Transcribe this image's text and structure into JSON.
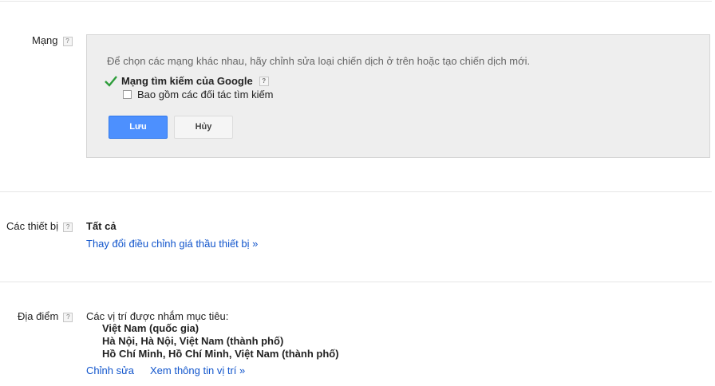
{
  "network": {
    "label": "Mạng",
    "help": "?",
    "note": "Để chọn các mạng khác nhau, hãy chỉnh sửa loại chiến dịch ở trên hoặc tạo chiến dịch mới.",
    "search_network": "Mạng tìm kiếm của Google",
    "search_partners": "Bao gồm các đối tác tìm kiếm",
    "save_label": "Lưu",
    "cancel_label": "Hủy"
  },
  "devices": {
    "label": "Các thiết bị",
    "help": "?",
    "value": "Tất cả",
    "change_link": "Thay đổi điều chỉnh giá thầu thiết bị »"
  },
  "locations": {
    "label": "Địa điểm",
    "help": "?",
    "targeted_label": "Các vị trí được nhắm mục tiêu:",
    "items": [
      "Việt Nam (quốc gia)",
      "Hà Nội, Hà Nội, Việt Nam (thành phố)",
      "Hồ Chí Minh, Hồ Chí Minh, Việt Nam (thành phố)"
    ],
    "edit_link": "Chỉnh sửa",
    "view_link": "Xem thông tin vị trí »"
  },
  "colors": {
    "link": "#1155cc",
    "primary_button": "#4d90fe",
    "check": "#2d9d3a",
    "panel_bg": "#eeeeee"
  }
}
